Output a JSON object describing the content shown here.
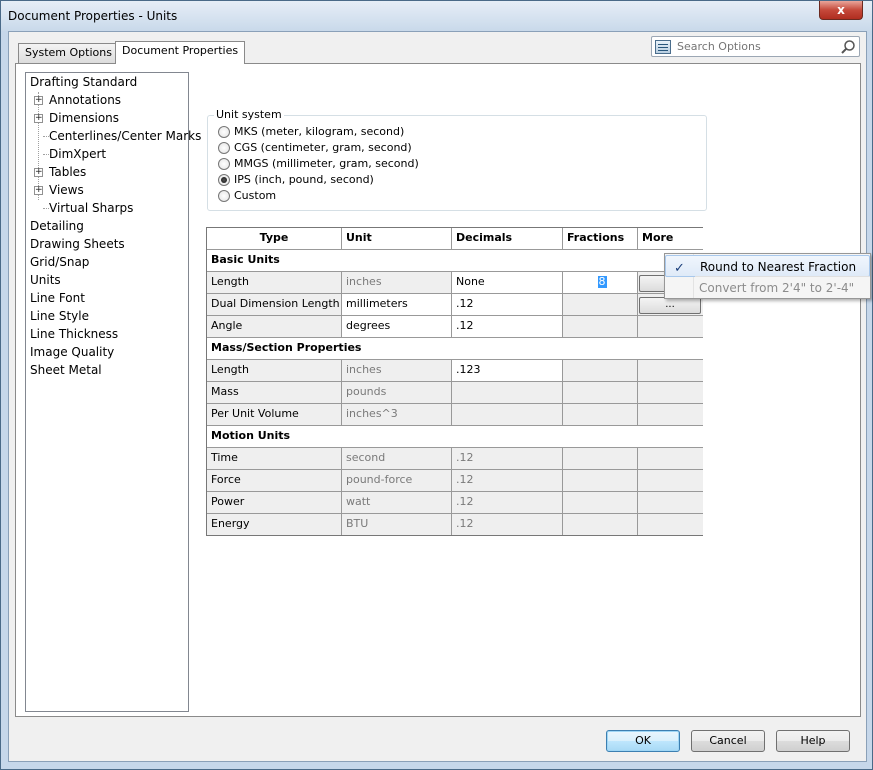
{
  "window": {
    "title": "Document Properties - Units",
    "close_label": "x"
  },
  "tabs": [
    {
      "label": "System Options"
    },
    {
      "label": "Document Properties"
    }
  ],
  "search": {
    "placeholder": "Search Options"
  },
  "tree": [
    {
      "label": "Drafting Standard",
      "expandable": false
    },
    {
      "label": "Annotations",
      "expandable": true
    },
    {
      "label": "Dimensions",
      "expandable": true
    },
    {
      "label": "Centerlines/Center Marks",
      "expandable": false
    },
    {
      "label": "DimXpert",
      "expandable": false
    },
    {
      "label": "Tables",
      "expandable": true
    },
    {
      "label": "Views",
      "expandable": true
    },
    {
      "label": "Virtual Sharps",
      "expandable": false
    },
    {
      "label": "Detailing",
      "expandable": false
    },
    {
      "label": "Drawing Sheets",
      "expandable": false
    },
    {
      "label": "Grid/Snap",
      "expandable": false
    },
    {
      "label": "Units",
      "expandable": false
    },
    {
      "label": "Line Font",
      "expandable": false
    },
    {
      "label": "Line Style",
      "expandable": false
    },
    {
      "label": "Line Thickness",
      "expandable": false
    },
    {
      "label": "Image Quality",
      "expandable": false
    },
    {
      "label": "Sheet Metal",
      "expandable": false
    }
  ],
  "unit_system": {
    "legend": "Unit system",
    "options": [
      {
        "label": "MKS  (meter, kilogram, second)",
        "selected": false
      },
      {
        "label": "CGS  (centimeter, gram, second)",
        "selected": false
      },
      {
        "label": "MMGS  (millimeter, gram, second)",
        "selected": false
      },
      {
        "label": "IPS  (inch, pound, second)",
        "selected": true
      },
      {
        "label": "Custom",
        "selected": false
      }
    ]
  },
  "grid": {
    "headers": {
      "type": "Type",
      "unit": "Unit",
      "decimals": "Decimals",
      "fractions": "Fractions",
      "more": "More"
    },
    "sections": {
      "basic": "Basic Units",
      "mass": "Mass/Section Properties",
      "motion": "Motion Units"
    },
    "rows": {
      "length": {
        "type": "Length",
        "unit": "inches",
        "decimals": "None",
        "fractions": "8",
        "more": "..."
      },
      "dual": {
        "type": "Dual Dimension Length",
        "unit": "millimeters",
        "decimals": ".12",
        "fractions": "",
        "more": "..."
      },
      "angle": {
        "type": "Angle",
        "unit": "degrees",
        "decimals": ".12"
      },
      "mlength": {
        "type": "Length",
        "unit": "inches",
        "decimals": ".123"
      },
      "mass": {
        "type": "Mass",
        "unit": "pounds",
        "decimals": ""
      },
      "volume": {
        "type": "Per Unit Volume",
        "unit": "inches^3",
        "decimals": ""
      },
      "time": {
        "type": "Time",
        "unit": "second",
        "decimals": ".12"
      },
      "force": {
        "type": "Force",
        "unit": "pound-force",
        "decimals": ".12"
      },
      "power": {
        "type": "Power",
        "unit": "watt",
        "decimals": ".12"
      },
      "energy": {
        "type": "Energy",
        "unit": "BTU",
        "decimals": ".12"
      }
    }
  },
  "context_menu": {
    "items": [
      {
        "label": "Round to Nearest Fraction",
        "checked": true,
        "enabled": true
      },
      {
        "label": "Convert from 2'4\" to 2'-4\"",
        "checked": false,
        "enabled": false
      }
    ]
  },
  "buttons": {
    "ok": "OK",
    "cancel": "Cancel",
    "help": "Help"
  },
  "colors": {
    "selection": "#3399ff",
    "close": "#c5493a",
    "default_button": "#3c7fb1"
  }
}
